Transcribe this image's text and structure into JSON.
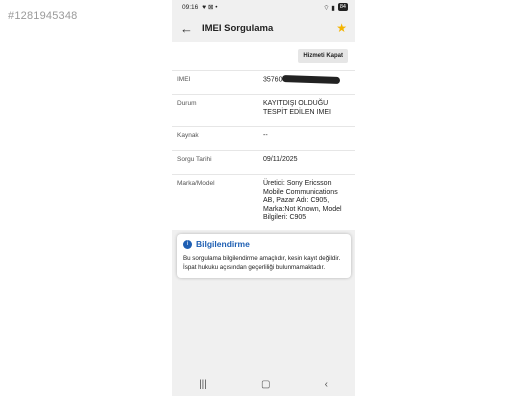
{
  "watermark": "#1281945348",
  "status": {
    "time": "09:16",
    "battery": "84"
  },
  "appbar": {
    "title": "IMEI Sorgulama"
  },
  "actions": {
    "close_label": "Hizmeti Kapat"
  },
  "fields": [
    {
      "key": "IMEI",
      "value": "35760"
    },
    {
      "key": "Durum",
      "value": "KAYITDIŞI OLDUĞU TESPİT EDİLEN IMEI"
    },
    {
      "key": "Kaynak",
      "value": "--"
    },
    {
      "key": "Sorgu Tarihi",
      "value": "09/11/2025"
    },
    {
      "key": "Marka/Model",
      "value": "Üretici: Sony Ericsson Mobile Communications AB, Pazar Adı: C905, Marka:Not Known, Model Bilgileri: C905"
    }
  ],
  "info": {
    "title": "Bilgilendirme",
    "body": "Bu sorgulama bilgilendirme amaçlıdır, kesin kayıt değildir. İspat hukuku açısından geçerliliği bulunmamaktadır."
  },
  "icons": {
    "back": "arrow-left-icon",
    "star": "star-icon",
    "info": "info-icon"
  }
}
